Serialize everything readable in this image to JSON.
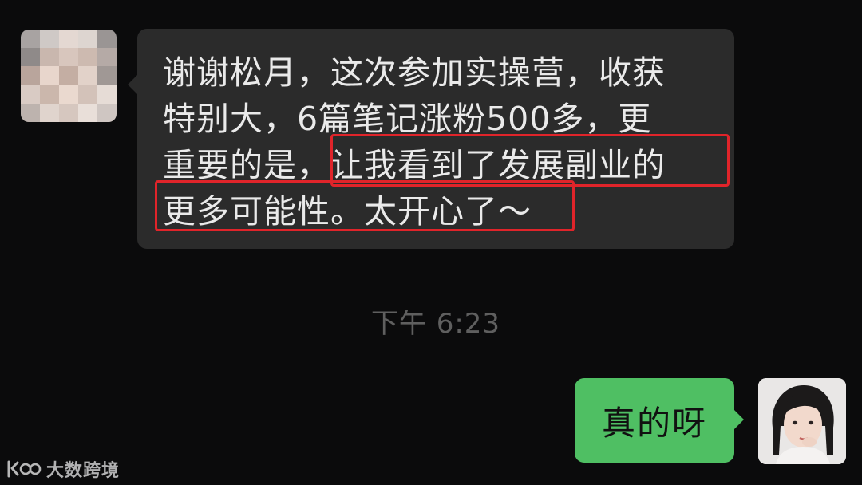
{
  "chat": {
    "incoming": {
      "lines": [
        "谢谢松月，这次参加实操营，收获",
        "特别大，6篇笔记涨粉500多，更",
        "重要的是，让我看到了发展副业的",
        "更多可能性。太开心了～"
      ]
    },
    "timestamp": "下午 6:23",
    "outgoing": {
      "text": "真的呀"
    }
  },
  "watermark": {
    "text": "大数跨境"
  },
  "colors": {
    "background": "#0b0b0c",
    "incoming_bubble": "#2b2b2b",
    "outgoing_bubble": "#4fbf63",
    "highlight_box": "#e0242a",
    "timestamp": "#5f5f5f"
  },
  "icons": {
    "left_avatar": "pixelated-avatar",
    "right_avatar": "girl-portrait-avatar",
    "watermark_logo": "logo-mark-icon"
  }
}
